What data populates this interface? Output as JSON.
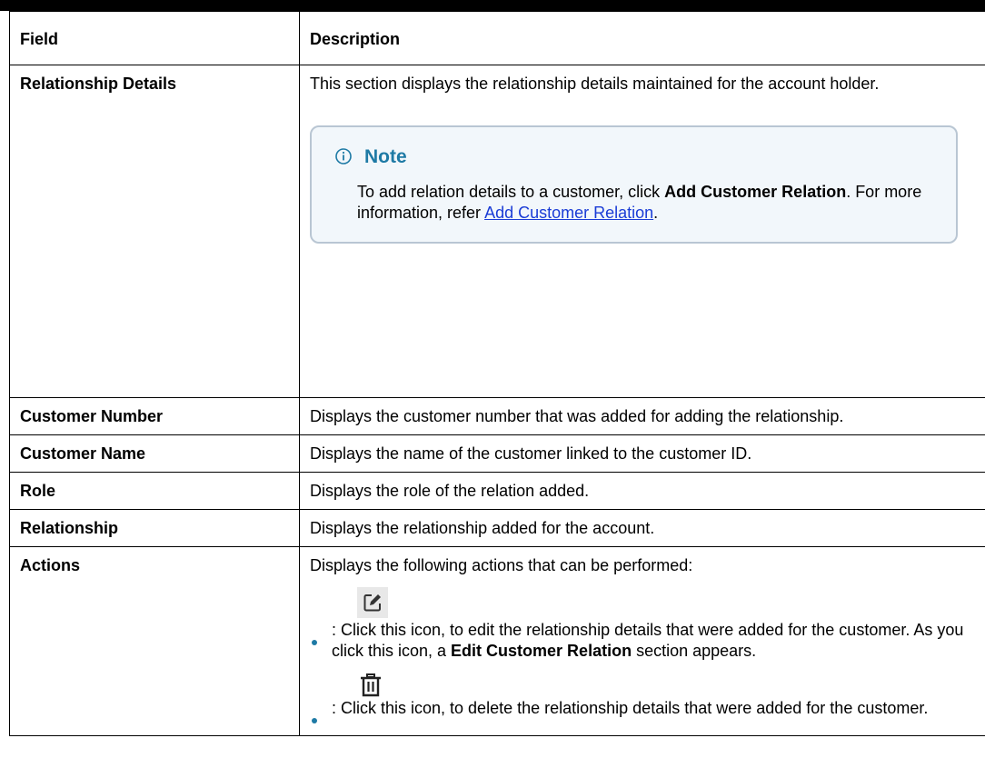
{
  "table": {
    "headers": {
      "field": "Field",
      "description": "Description"
    },
    "rows": [
      {
        "field": "Relationship Details",
        "description": "This section displays the relationship details maintained for the account holder."
      },
      {
        "field": "Customer Number",
        "description": "Displays the customer number that was added for adding the relationship."
      },
      {
        "field": "Customer Name",
        "description": "Displays the name of the customer linked to the customer ID."
      },
      {
        "field": "Role",
        "description": "Displays the role of the relation added."
      },
      {
        "field": "Relationship",
        "description": "Displays the relationship added for the account."
      },
      {
        "field": "Actions",
        "description": "Displays the following actions that can be performed:"
      }
    ]
  },
  "note": {
    "title": "Note",
    "text_1": "To add relation details to a customer, click ",
    "bold_1": "Add Customer Relation",
    "text_2": ". For more information, refer ",
    "link": "Add Customer Relation",
    "text_3": "."
  },
  "actions": {
    "edit": {
      "icon": "edit-icon",
      "text_1": ": Click this icon, to edit the relationship details that were added for the customer. As you click this icon, a ",
      "bold": "Edit Customer Relation",
      "text_2": " section appears."
    },
    "delete": {
      "icon": "trash-icon",
      "text": ": Click this icon, to delete the relationship details that were added for the customer."
    }
  },
  "colors": {
    "note_title": "#1e7aa5",
    "link": "#1a3cd6",
    "note_border": "#b9c6d3",
    "bullet": "#1e7aa5"
  }
}
